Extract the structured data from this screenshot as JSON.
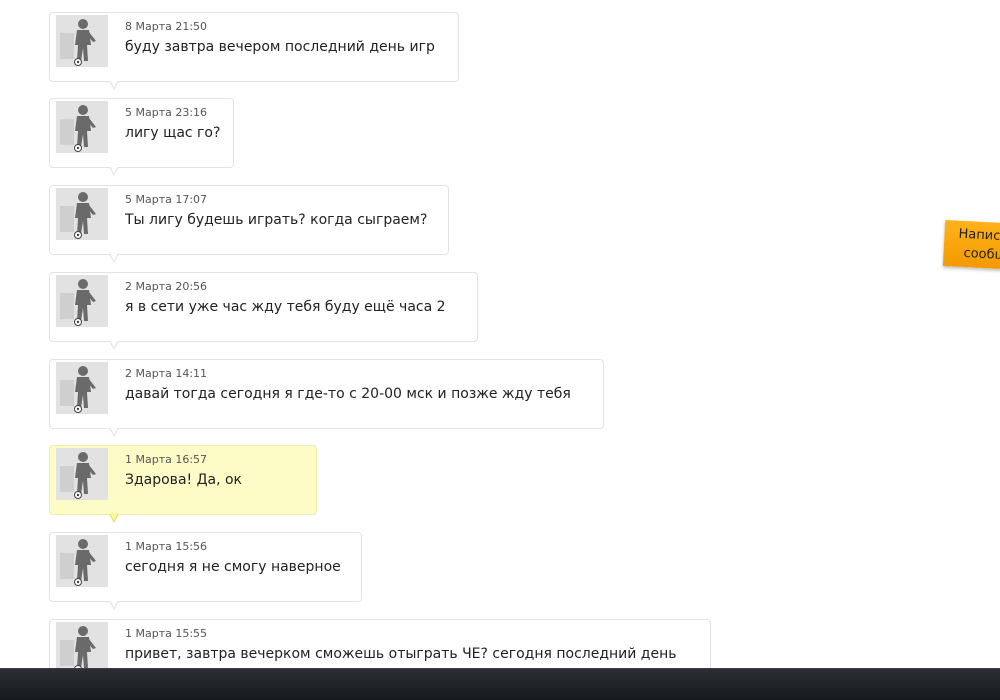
{
  "messages": [
    {
      "date": "8 Марта 21:50",
      "text": "буду завтра вечером последний день игр",
      "mine": false
    },
    {
      "date": "5 Марта 23:16",
      "text": "лигу щас го?",
      "mine": false
    },
    {
      "date": "5 Марта 17:07",
      "text": "Ты лигу будешь играть? когда сыграем?",
      "mine": false
    },
    {
      "date": "2 Марта 20:56",
      "text": "я в сети уже час жду тебя буду ещё часа 2",
      "mine": false
    },
    {
      "date": "2 Марта 14:11",
      "text": "давай тогда сегодня я где-то с 20-00 мск и позже жду тебя",
      "mine": false
    },
    {
      "date": "1 Марта 16:57",
      "text": "Здарова! Да, ок",
      "mine": true
    },
    {
      "date": "1 Марта 15:56",
      "text": "сегодня я не смогу наверное",
      "mine": false
    },
    {
      "date": "1 Марта 15:55",
      "text": "привет, завтра вечерком сможешь отыграть ЧЕ? сегодня последний день",
      "mine": false
    }
  ],
  "write_message_tab": {
    "line1": "Написать",
    "line2": "сообщение"
  },
  "colors": {
    "own_message_bg": "#fdfcc6",
    "tab_orange": "#f7a40c",
    "bottom_bar": "#1e2225"
  },
  "icons": {
    "avatar": "footballer-silhouette-icon"
  }
}
